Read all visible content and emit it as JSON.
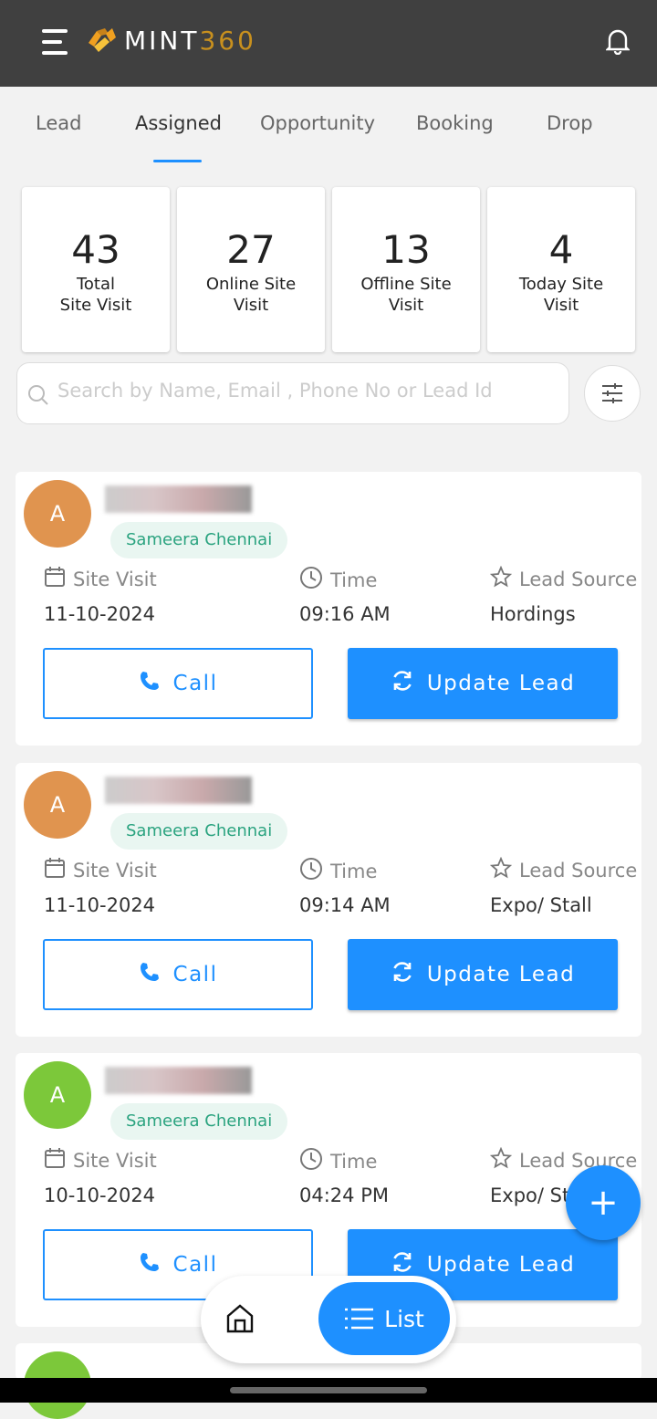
{
  "header": {
    "brand_left": "MINT",
    "brand_right": "360",
    "colors": {
      "bar": "#404040",
      "accent": "#c8901e"
    }
  },
  "tabs": [
    {
      "label": "Lead"
    },
    {
      "label": "Assigned",
      "active": true
    },
    {
      "label": "Opportunity"
    },
    {
      "label": "Booking"
    },
    {
      "label": "Drop"
    }
  ],
  "stats": [
    {
      "value": "43",
      "label": "Total Site Visit"
    },
    {
      "value": "27",
      "label": "Online Site Visit"
    },
    {
      "value": "13",
      "label": "Offline Site Visit"
    },
    {
      "value": "4",
      "label": "Today Site Visit"
    }
  ],
  "search": {
    "placeholder": "Search by Name, Email , Phone No or Lead Id",
    "value": ""
  },
  "labels": {
    "site_visit": "Site Visit",
    "time": "Time",
    "lead_source": "Lead Source",
    "call": "Call",
    "update": "Update Lead"
  },
  "leads": [
    {
      "initial": "A",
      "avatar_color": "#e0944f",
      "owner": "Sameera Chennai",
      "date": "11-10-2024",
      "time": "09:16 AM",
      "source": "Hordings"
    },
    {
      "initial": "A",
      "avatar_color": "#e0944f",
      "owner": "Sameera Chennai",
      "date": "11-10-2024",
      "time": "09:14 AM",
      "source": "Expo/ Stall"
    },
    {
      "initial": "A",
      "avatar_color": "#7cc83a",
      "owner": "Sameera Chennai",
      "date": "10-10-2024",
      "time": "04:24 PM",
      "source": "Expo/ Stall"
    }
  ],
  "partial_lead": {
    "avatar_color": "#7cc83a"
  },
  "fab": "+",
  "bottom_nav": {
    "list_label": "List"
  },
  "accent": "#1e90ff"
}
